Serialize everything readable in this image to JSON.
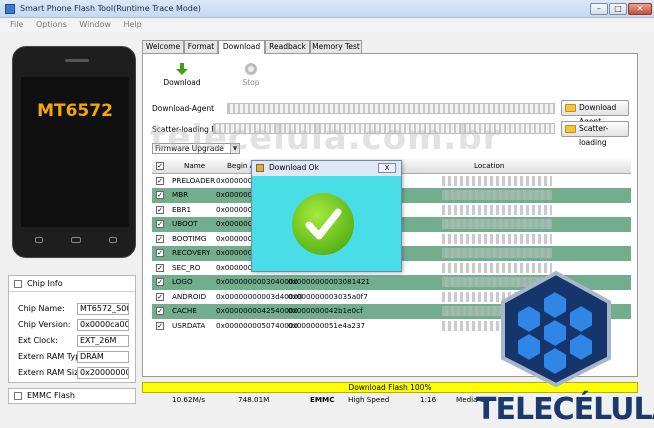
{
  "window": {
    "title": "Smart Phone Flash Tool(Runtime Trace Mode)"
  },
  "menu": [
    "File",
    "Options",
    "Window",
    "Help"
  ],
  "phone": {
    "chip": "MT6572"
  },
  "chip_info": {
    "title": "Chip Info",
    "rows": [
      {
        "label": "Chip Name:",
        "value": "MT6572_S00"
      },
      {
        "label": "Chip Version:",
        "value": "0x0000ca00"
      },
      {
        "label": "Ext Clock:",
        "value": "EXT_26M"
      },
      {
        "label": "Extern RAM Type:",
        "value": "DRAM"
      },
      {
        "label": "Extern RAM Size:",
        "value": "0x20000000"
      }
    ]
  },
  "emmc_label": "EMMC Flash",
  "tabs": [
    "Welcome",
    "Format",
    "Download",
    "Readback",
    "Memory Test"
  ],
  "toolbar": {
    "download": "Download",
    "stop": "Stop"
  },
  "download_agent_label": "Download-Agent",
  "scatter_label": "Scatter-loading File",
  "download_agent_button": "Download Agent",
  "scatter_button": "Scatter-loading",
  "mode_select": "Firmware Upgrade",
  "table": {
    "headers": [
      "Name",
      "Begin A",
      "Location"
    ],
    "rows": [
      {
        "name": "PRELOADER",
        "begin": "0x0000000",
        "end": ""
      },
      {
        "name": "MBR",
        "begin": "0x0000000",
        "end": ""
      },
      {
        "name": "EBR1",
        "begin": "0x0000000",
        "end": ""
      },
      {
        "name": "UBOOT",
        "begin": "0x0000000",
        "end": ""
      },
      {
        "name": "BOOTIMG",
        "begin": "0x0000000",
        "end": ""
      },
      {
        "name": "RECOVERY",
        "begin": "0x0000000",
        "end": ""
      },
      {
        "name": "SEC_RO",
        "begin": "0x0000000",
        "end": ""
      },
      {
        "name": "LOGO",
        "begin": "0x0000000003040000",
        "end": "0x0000000003081421"
      },
      {
        "name": "ANDROID",
        "begin": "0x00000000003d40000",
        "end": "0x000000003035a0f7"
      },
      {
        "name": "CACHE",
        "begin": "0x0000000042540000",
        "end": "0x000000042b1e0cf"
      },
      {
        "name": "USRDATA",
        "begin": "0x0000000050740000",
        "end": "0x000000051e4a237"
      }
    ]
  },
  "dialog": {
    "title": "Download Ok",
    "close": "X"
  },
  "progress_text": "Download Flash 100%",
  "status": {
    "speed": "10.62M/s",
    "size": "748.01M",
    "storage": "EMMC",
    "mode": "High Speed",
    "time": "1:16",
    "extra": "Media St"
  },
  "watermark": "telecelula.com.br",
  "brand": "TELECÉLULA"
}
